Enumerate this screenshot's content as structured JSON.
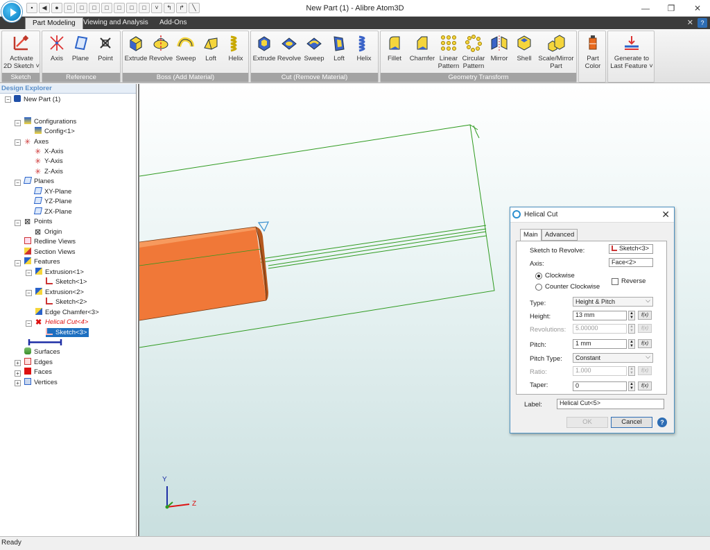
{
  "window": {
    "title": "New Part (1) - Alibre Atom3D"
  },
  "qat_icons": [
    "save-icon",
    "undo-icon",
    "redo-icon",
    "view-front-icon",
    "view-back-icon",
    "view-left-icon",
    "view-right-icon",
    "view-top-icon",
    "view-bottom-icon",
    "view-iso-icon",
    "dropdown-icon",
    "rotate-icon",
    "flip-icon",
    "line-icon"
  ],
  "tabs": [
    {
      "label": "Part Modeling",
      "active": true
    },
    {
      "label": "Viewing and Analysis",
      "active": false
    },
    {
      "label": "Add-Ons",
      "active": false
    }
  ],
  "ribbon": {
    "sketch": {
      "label": "Sketch",
      "activate_line1": "Activate",
      "activate_line2": "2D Sketch ˅"
    },
    "reference": {
      "label": "Reference",
      "axis": "Axis",
      "plane": "Plane",
      "point": "Point"
    },
    "boss": {
      "label": "Boss (Add Material)",
      "extrude": "Extrude",
      "revolve": "Revolve",
      "sweep": "Sweep",
      "loft": "Loft",
      "helix": "Helix"
    },
    "cut": {
      "label": "Cut (Remove Material)",
      "extrude": "Extrude",
      "revolve": "Revolve",
      "sweep": "Sweep",
      "loft": "Loft",
      "helix": "Helix"
    },
    "geometry": {
      "label": "Geometry Transform",
      "fillet": "Fillet",
      "chamfer": "Chamfer",
      "linear1": "Linear",
      "linear2": "Pattern",
      "circular1": "Circular",
      "circular2": "Pattern",
      "mirror": "Mirror",
      "shell": "Shell",
      "scale1": "Scale/Mirror",
      "scale2": "Part"
    },
    "color": {
      "line1": "Part",
      "line2": "Color"
    },
    "generate": {
      "line1": "Generate to",
      "line2": "Last Feature ˅"
    }
  },
  "explorer": {
    "title": "Design Explorer",
    "items": [
      {
        "label": "New Part (1)"
      },
      {
        "label": "Configurations"
      },
      {
        "label": "Config<1>"
      },
      {
        "label": "Axes"
      },
      {
        "label": "X-Axis"
      },
      {
        "label": "Y-Axis"
      },
      {
        "label": "Z-Axis"
      },
      {
        "label": "Planes"
      },
      {
        "label": "XY-Plane"
      },
      {
        "label": "YZ-Plane"
      },
      {
        "label": "ZX-Plane"
      },
      {
        "label": "Points"
      },
      {
        "label": "Origin"
      },
      {
        "label": "Redline Views"
      },
      {
        "label": "Section Views"
      },
      {
        "label": "Features"
      },
      {
        "label": "Extrusion<1>"
      },
      {
        "label": "Sketch<1>"
      },
      {
        "label": "Extrusion<2>"
      },
      {
        "label": "Sketch<2>"
      },
      {
        "label": "Edge Chamfer<3>"
      },
      {
        "label": "Helical Cut<4>"
      },
      {
        "label": "Sketch<3>"
      },
      {
        "label": ""
      },
      {
        "label": "Surfaces"
      },
      {
        "label": "Edges"
      },
      {
        "label": "Faces"
      },
      {
        "label": "Vertices"
      }
    ]
  },
  "viewport": {
    "axis_y": "Y",
    "axis_z": "Z"
  },
  "dialog": {
    "title": "Helical Cut",
    "tab_main": "Main",
    "tab_advanced": "Advanced",
    "sketch_label": "Sketch to Revolve:",
    "sketch_value": "Sketch<3>",
    "axis_label": "Axis:",
    "axis_value": "Face<2>",
    "clockwise": "Clockwise",
    "counter_clockwise": "Counter Clockwise",
    "reverse": "Reverse",
    "type_label": "Type:",
    "type_value": "Height & Pitch",
    "height_label": "Height:",
    "height_value": "13 mm",
    "revolutions_label": "Revolutions:",
    "revolutions_value": "5.00000",
    "pitch_label": "Pitch:",
    "pitch_value": "1 mm",
    "pitch_type_label": "Pitch Type:",
    "pitch_type_value": "Constant",
    "ratio_label": "Ratio:",
    "ratio_value": "1.000",
    "taper_label": "Taper:",
    "taper_value": "0",
    "fx": "f(x)",
    "name_label": "Label:",
    "name_value": "Helical Cut<5>",
    "ok": "OK",
    "cancel": "Cancel",
    "help": "?"
  },
  "status": {
    "text": "Ready"
  },
  "colors": {
    "accent": "#2e6db4",
    "part": "#f07838",
    "wire": "#2e9a1e",
    "ribbon_label": "#a3a3a3"
  }
}
